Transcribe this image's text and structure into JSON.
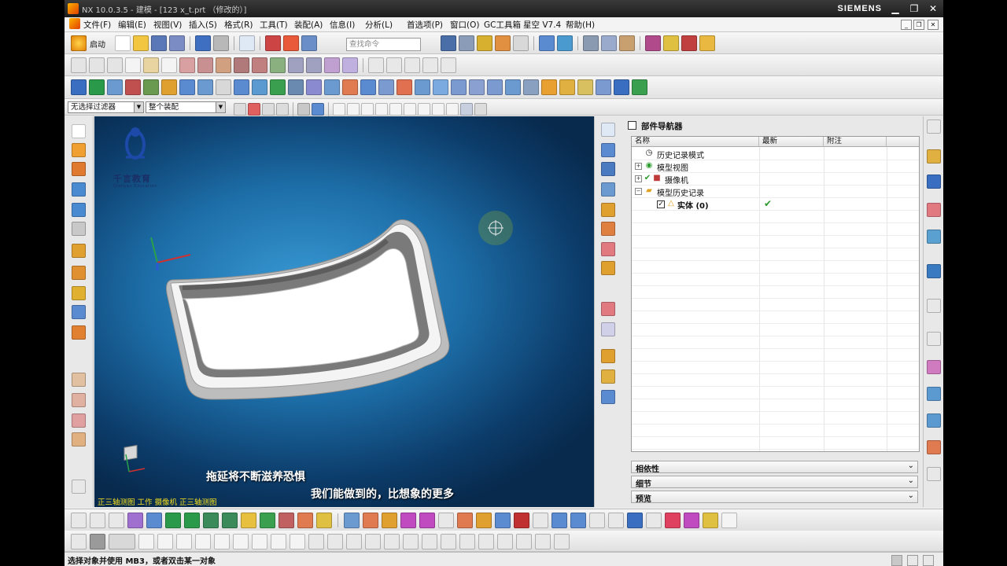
{
  "window": {
    "title": "NX 10.0.3.5 - 建模 - [123 x_t.prt （修改的）]",
    "brand": "SIEMENS"
  },
  "menubar": {
    "items": [
      "文件(F)",
      "编辑(E)",
      "视图(V)",
      "插入(S)",
      "格式(R)",
      "工具(T)",
      "装配(A)",
      "信息(I)",
      "分析(L)",
      "首选项(P)",
      "窗口(O)",
      "GC工具箱",
      "星空 V7.4",
      "帮助(H)"
    ]
  },
  "toolbar": {
    "start_label": "启动",
    "command_search_placeholder": "查找命令"
  },
  "selection_bar": {
    "filter_value": "无选择过滤器",
    "scope_value": "整个装配"
  },
  "viewport": {
    "caption_line1": "拖延将不断滋养恐惧",
    "caption_line2": "我们能做到的，比想象的更多",
    "view_status": "正三轴测图  工作  摄像机  正三轴测图",
    "watermark_title": "千言教育",
    "watermark_sub": "Qianyan Education"
  },
  "navigator": {
    "title": "部件导航器",
    "columns": [
      "名称",
      "最新",
      "附注"
    ],
    "rows": [
      {
        "label": "历史记录模式",
        "icon": "clock-icon",
        "expand": "",
        "latest": ""
      },
      {
        "label": "模型视图",
        "icon": "model-views-icon",
        "expand": "+",
        "latest": ""
      },
      {
        "label": "摄像机",
        "icon": "camera-icon",
        "expand": "+",
        "latest": ""
      },
      {
        "label": "模型历史记录",
        "icon": "folder-icon",
        "expand": "−",
        "latest": ""
      },
      {
        "label": "实体 (0)",
        "icon": "body-icon",
        "expand": "",
        "latest": "✔"
      }
    ],
    "panels": [
      "相依性",
      "细节",
      "预览"
    ]
  },
  "statusbar": {
    "text": "选择对象并使用 MB3，或者双击某一对象"
  },
  "colors": {
    "accent_blue": "#1d6ea8",
    "check_green": "#2a9a2a",
    "caption_yellow": "#f4e020"
  }
}
